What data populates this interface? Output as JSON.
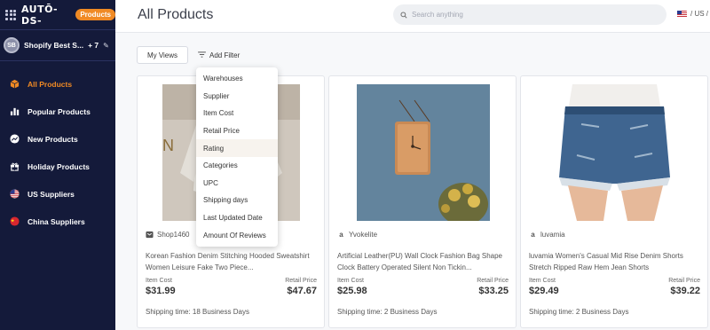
{
  "brand": {
    "logo": "AUTŌ-DS-",
    "badge": "Products"
  },
  "store": {
    "initials": "SB",
    "name": "Shopify Best S...",
    "extra": "+ 7"
  },
  "sidebar": {
    "items": [
      {
        "label": "All Products",
        "icon": "box-icon"
      },
      {
        "label": "Popular Products",
        "icon": "bar-chart-icon"
      },
      {
        "label": "New Products",
        "icon": "trend-icon"
      },
      {
        "label": "Holiday Products",
        "icon": "gift-icon"
      },
      {
        "label": "US Suppliers",
        "icon": "us-flag-icon"
      },
      {
        "label": "China Suppliers",
        "icon": "china-flag-icon"
      }
    ]
  },
  "header": {
    "title": "All Products",
    "search_placeholder": "Search anything",
    "locale": "/ US /"
  },
  "toolbar": {
    "views_label": "My Views",
    "filter_label": "Add Filter"
  },
  "filter_menu": {
    "items": [
      "Warehouses",
      "Supplier",
      "Item Cost",
      "Retail Price",
      "Rating",
      "Categories",
      "UPC",
      "Shipping days",
      "Last Updated Date",
      "Amount Of Reviews"
    ],
    "hovered": "Rating"
  },
  "labels": {
    "cost": "Item Cost",
    "retail": "Retail Price"
  },
  "products": [
    {
      "supplier": "Shop1460",
      "supplier_icon": "store-icon",
      "title": "Korean Fashion Denim Stitching Hooded Sweatshirt Women Leisure Fake Two Piece...",
      "cost": "$31.99",
      "retail": "$47.67",
      "shipping": "Shipping time: 18 Business Days"
    },
    {
      "supplier": "Yvokelite",
      "supplier_icon": "amazon-icon",
      "title": "Artificial Leather(PU) Wall Clock Fashion Bag Shape Clock Battery Operated Silent Non Tickin...",
      "cost": "$25.98",
      "retail": "$33.25",
      "shipping": "Shipping time: 2 Business Days"
    },
    {
      "supplier": "luvamia",
      "supplier_icon": "amazon-icon",
      "title": "luvamia Women's Casual Mid Rise Denim Shorts Stretch Ripped Raw Hem Jean Shorts",
      "cost": "$29.49",
      "retail": "$39.22",
      "shipping": "Shipping time: 2 Business Days"
    }
  ],
  "colors": {
    "sidebar_bg": "#141a3a",
    "accent": "#f08a24"
  }
}
